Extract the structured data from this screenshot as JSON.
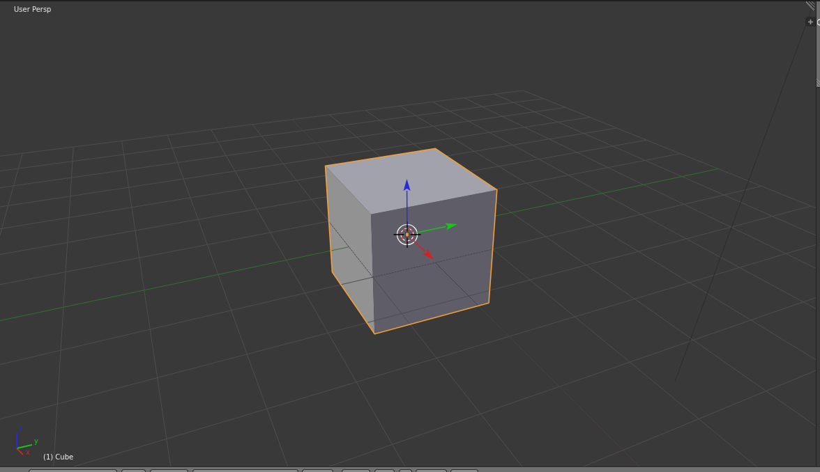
{
  "viewport": {
    "view_name": "User Persp",
    "object": {
      "label": "(1) Cube",
      "selected": true
    },
    "axes": [
      {
        "label": "x",
        "color": "#d82020"
      },
      {
        "label": "y",
        "color": "#1cc21c"
      },
      {
        "label": "z",
        "color": "#2a2ad8"
      }
    ]
  }
}
